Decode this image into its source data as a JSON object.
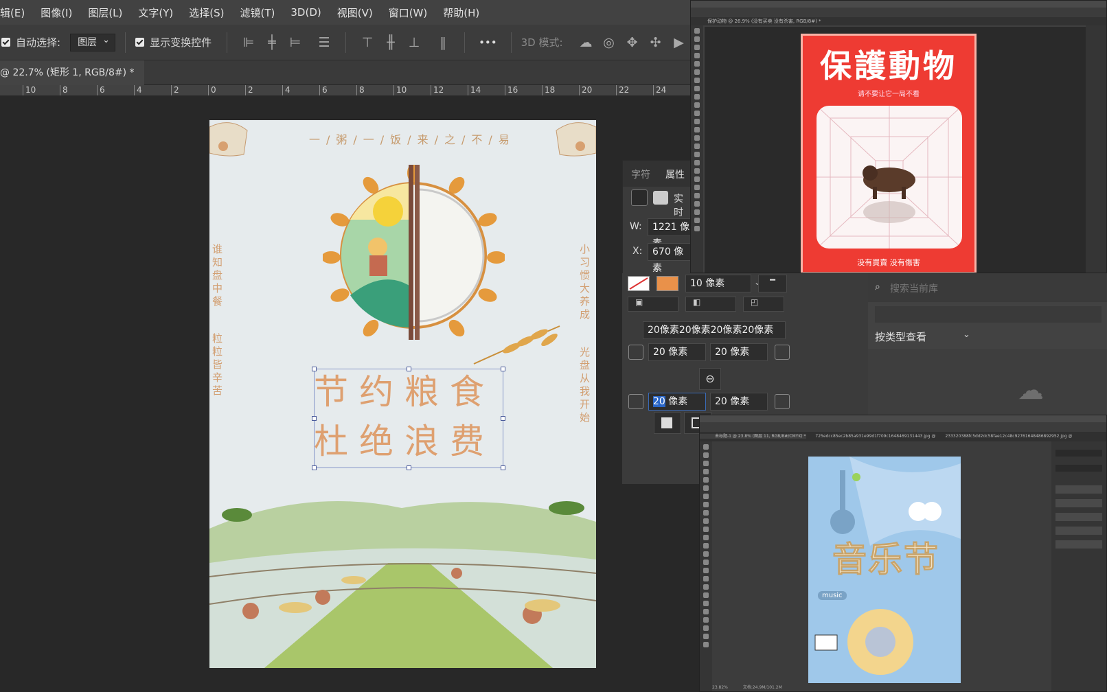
{
  "menu": [
    "辑(E)",
    "图像(I)",
    "图层(L)",
    "文字(Y)",
    "选择(S)",
    "滤镜(T)",
    "3D(D)",
    "视图(V)",
    "窗口(W)",
    "帮助(H)"
  ],
  "options": {
    "auto_select_label": "自动选择:",
    "layer_select": "图层",
    "show_transform_label": "显示变换控件",
    "mode_3d": "3D 模式:",
    "more": "•••"
  },
  "doc_tab": {
    "title": "@ 22.7% (矩形 1, RGB/8#) *",
    "close": "×"
  },
  "ruler_ticks": [
    "10",
    "8",
    "6",
    "4",
    "2",
    "0",
    "2",
    "4",
    "6",
    "8",
    "10",
    "12",
    "14",
    "16",
    "18",
    "20",
    "22",
    "24"
  ],
  "poster": {
    "top_line": "一/粥/一/饭/来/之/不/易",
    "left_vertical_1": "谁知盘中餐",
    "left_vertical_2": "粒粒皆辛苦",
    "right_vertical_1": "小习惯大养成",
    "right_vertical_2": "光盘从我开始",
    "main_title_line1": "节约粮食",
    "main_title_line2": "杜绝浪费"
  },
  "properties_panel": {
    "tab_character": "字符",
    "tab_properties": "属性",
    "fill_label": "实时",
    "w_label": "W:",
    "w_value": "1221 像素",
    "x_label": "X:",
    "x_value": "670 像素",
    "stroke_width": "10 像素",
    "corner_summary": "20像素20像素20像素20像素",
    "corner_tl": "20 像素",
    "corner_tr": "20 像素",
    "corner_bl": "20 像素",
    "corner_br": "20 像素",
    "corner_bl_selected": "20"
  },
  "library_panel": {
    "search_placeholder": "搜索当前库",
    "view_by_type": "按类型查看"
  },
  "window1": {
    "tab": "保护动物 @ 26.9% (没有买卖 没有杀害, RGB/8#) *",
    "poster_title": "保護動物",
    "poster_subtitle": "请不要让它一局不看",
    "poster_footer": "没有買賣  没有傷害"
  },
  "window2": {
    "tab_active": "未标题-1 @ 23.8% (图层 11, RGB/8#/CMYK) *",
    "tab2": "725edcc85ec2b85a931e99d1f709c1648469131443.jpg @",
    "tab3": "233320388fc5dd2dc58fae12c48c92761648486892952.jpg @",
    "poster_title": "音乐节",
    "poster_tag": "music",
    "status": "23.82%",
    "status_doc": "文档:24.9M/101.2M"
  },
  "colors": {
    "accent_orange": "#e9914a",
    "poster_red": "#ee3b33",
    "poster_blue": "#9fc8ea",
    "selection_blue": "#8494c8"
  }
}
